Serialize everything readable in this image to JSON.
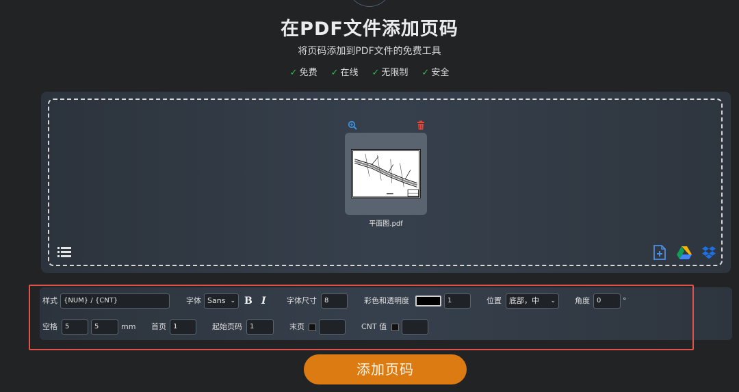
{
  "header": {
    "title": "在PDF文件添加页码",
    "subtitle": "将页码添加到PDF文件的免费工具",
    "features": [
      "免费",
      "在线",
      "无限制",
      "安全"
    ],
    "check_glyph": "✓"
  },
  "uploader": {
    "file_name": "平面图.pdf",
    "icons": [
      "zoom-in-icon",
      "trash-icon",
      "list-icon",
      "add-file-icon",
      "google-drive-icon",
      "dropbox-icon"
    ]
  },
  "options": {
    "style_label": "样式",
    "style_value": "{NUM} / {CNT}",
    "font_label": "字体",
    "font_value": "Sans",
    "bold_label": "B",
    "italic_label": "I",
    "font_size_label": "字体尺寸",
    "font_size_value": "8",
    "color_label": "彩色和透明度",
    "color_value": "#000000",
    "opacity_value": "1",
    "position_label": "位置",
    "position_value": "底部，中",
    "angle_label": "角度",
    "angle_value": "0",
    "angle_unit": "°",
    "margin_label": "空格",
    "margin_x": "5",
    "margin_y": "5",
    "margin_unit": "mm",
    "first_page_label": "首页",
    "first_page_value": "1",
    "start_number_label": "起始页码",
    "start_number_value": "1",
    "last_page_label": "末页",
    "last_page_value": "",
    "cnt_label": "CNT 值",
    "cnt_value": ""
  },
  "submit": {
    "label": "添加页码"
  },
  "colors": {
    "background": "#222325",
    "accent_button": "#dc7b12",
    "highlight": "#e0534a",
    "check": "#3fb950",
    "trash": "#e0473d",
    "zoom": "#3d8fe0"
  }
}
